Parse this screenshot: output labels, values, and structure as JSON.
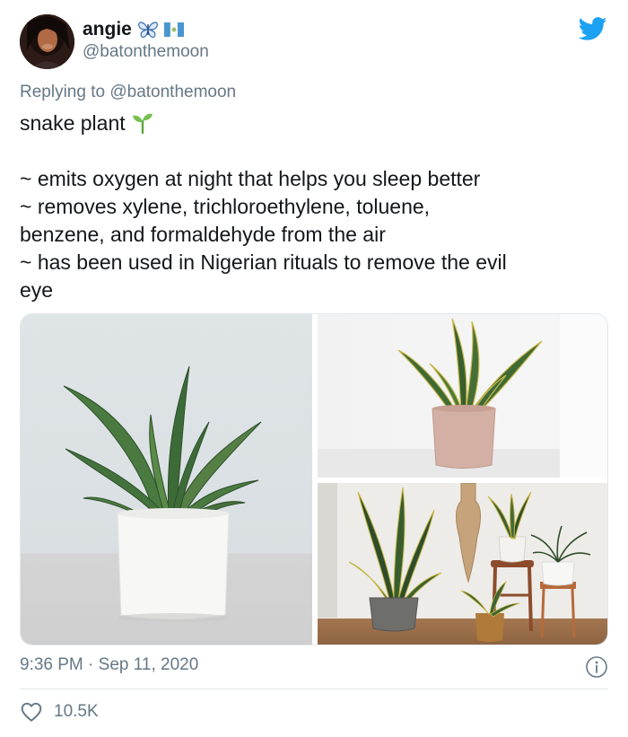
{
  "author": {
    "display_name": "angie",
    "handle": "@batonthemoon",
    "badges": [
      "butterfly-icon",
      "guatemala-flag-icon"
    ]
  },
  "brand_icon": "twitter-bird-icon",
  "reply": {
    "prefix": "Replying to",
    "mention": "@batonthemoon"
  },
  "tweet": {
    "title": "snake plant",
    "title_emoji": "seedling-icon",
    "lines": [
      "~ emits oxygen at night that helps you sleep better",
      "~ removes xylene, trichloroethylene, toluene,",
      "benzene, and formaldehyde from the air",
      "~ has been used in Nigerian rituals to remove the evil",
      "eye"
    ]
  },
  "media": {
    "count": 3,
    "images": [
      "snake-plant-white-pot-photo",
      "snake-plant-pink-pot-photo",
      "snake-plants-living-room-photo"
    ]
  },
  "timestamp": "9:36 PM · Sep 11, 2020",
  "likes": "10.5K",
  "colors": {
    "text": "#14171a",
    "secondary": "#657786",
    "twitter_blue": "#1da1f2",
    "divider": "#e1e8ed"
  }
}
